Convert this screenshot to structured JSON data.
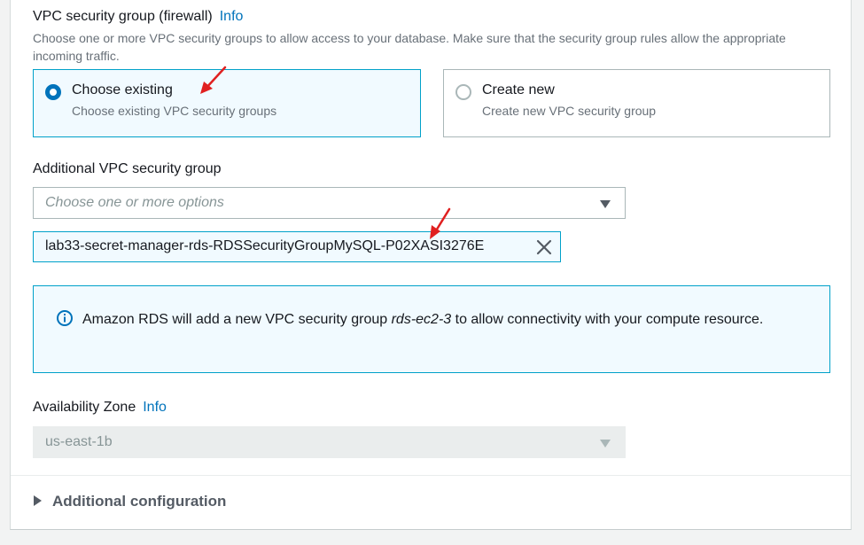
{
  "security_group": {
    "label": "VPC security group (firewall)",
    "info": "Info",
    "description": "Choose one or more VPC security groups to allow access to your database. Make sure that the security group rules allow the appropriate incoming traffic.",
    "options": [
      {
        "title": "Choose existing",
        "subtitle": "Choose existing VPC security groups",
        "selected": true
      },
      {
        "title": "Create new",
        "subtitle": "Create new VPC security group",
        "selected": false
      }
    ]
  },
  "additional_group": {
    "label": "Additional VPC security group",
    "placeholder": "Choose one or more options",
    "token": "lab33-secret-manager-rds-RDSSecurityGroupMySQL-P02XASI3276E"
  },
  "alert": {
    "text_before": "Amazon RDS will add a new VPC security group ",
    "group_name": "rds-ec2-3",
    "text_after": " to allow connectivity with your compute resource."
  },
  "availability_zone": {
    "label": "Availability Zone",
    "info": "Info",
    "value": "us-east-1b"
  },
  "additional_configuration": {
    "label": "Additional configuration"
  },
  "colors": {
    "accent": "#0073bb",
    "selected_border": "#00a1c9",
    "selected_bg": "#f1faff",
    "annotation_arrow": "#e02020"
  }
}
